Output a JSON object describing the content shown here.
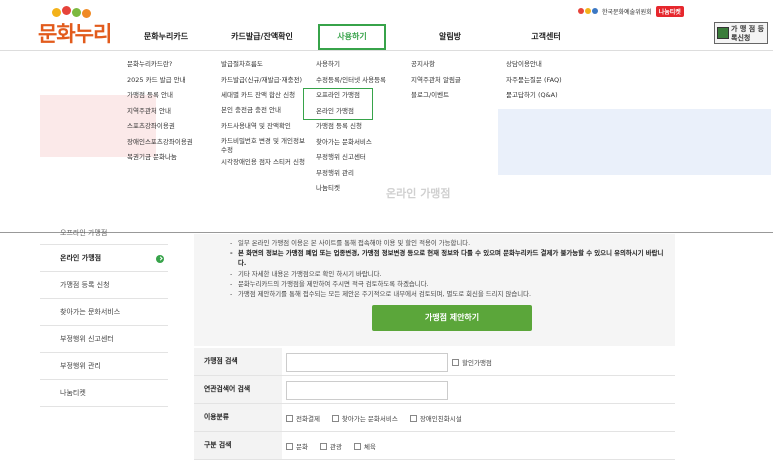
{
  "header": {
    "logo": "문화누리",
    "org_name": "한국문화예술위원회",
    "ticket_label": "나눔티켓",
    "register_banner": "가 맹 점 등록신청"
  },
  "gnb": [
    {
      "label": "문화누리카드"
    },
    {
      "label": "카드발급/잔액확인"
    },
    {
      "label": "사용하기"
    },
    {
      "label": "알림방"
    },
    {
      "label": "고객센터"
    }
  ],
  "mega_menu": {
    "col1": [
      "문화누리카드란?",
      "2025 카드 발급 안내",
      "가맹점 등록 안내",
      "지역주관처 안내",
      "스포츠강좌이용권",
      "장애인스포츠강좌이용권",
      "복권기금 문화나눔"
    ],
    "col2": [
      "발급절차흐름도",
      "카드발급(신규/재발급·재충전)",
      "세대별 카드 잔액 합산 신청",
      "본인 충전금 충전 안내",
      "카드사용내역 및 잔액확인",
      "카드비밀번호 변경 및 개인정보수정",
      "시각장애인용 점자 스티커 신청"
    ],
    "col3": [
      "사용하기",
      "수정등록/인터넷 사용등록",
      "오프라인 가맹점",
      "온라인 가맹점",
      "가맹점 등록 신청",
      "찾아가는 문화서비스",
      "부정행위 신고센터",
      "부정행위 관리",
      "나눔티켓"
    ],
    "col4": [
      "공지사항",
      "지역주관처 알림글",
      "블로그/이벤트"
    ],
    "col5": [
      "상담이용안내",
      "자주묻는질문 (FAQ)",
      "묻고답하기 (Q&A)"
    ],
    "bg_page_title": "온라인 가맹점"
  },
  "sidebar": {
    "items": [
      {
        "label": "오프라인 가맹점"
      },
      {
        "label": "온라인 가맹점"
      },
      {
        "label": "가맹점 등록 신청"
      },
      {
        "label": "찾아가는 문화서비스"
      },
      {
        "label": "부정행위 신고센터"
      },
      {
        "label": "부정행위 관리"
      },
      {
        "label": "나눔티켓"
      }
    ]
  },
  "notice": [
    "일부 온라인 가맹점 이용은 본 사이트를 통해 접속해야 이용 및 할인 적용이 가능합니다.",
    "본 화면의 정보는 가맹점 폐업 또는 업종변경, 가맹점 정보변경 등으로 현재 정보와 다를 수 있으며 문화누리카드 결제가 불가능할 수 있으니 유의하시기 바랍니다.",
    "기타 자세한 내용은 가맹점으로 확인 하시기 바랍니다.",
    "문화누리카드의 가맹점을 제안하여 주시면 적극 검토하도록 하겠습니다.",
    "가맹점 제안하기를 통해 접수되는 모든 제안은 주기적으로 내부에서 검토되며, 별도로 회신을 드리지 않습니다."
  ],
  "propose_button": "가맹점 제안하기",
  "search": {
    "store_label": "가맹점 검색",
    "discount_label": "할인가맹점",
    "related_label": "연관검색어 검색",
    "category_label": "이용분류",
    "category_options": [
      "전화결제",
      "찾아가는 문화서비스",
      "장애인친화시설"
    ],
    "type_label": "구분 검색",
    "type_options": [
      "문화",
      "관광",
      "체육"
    ]
  }
}
